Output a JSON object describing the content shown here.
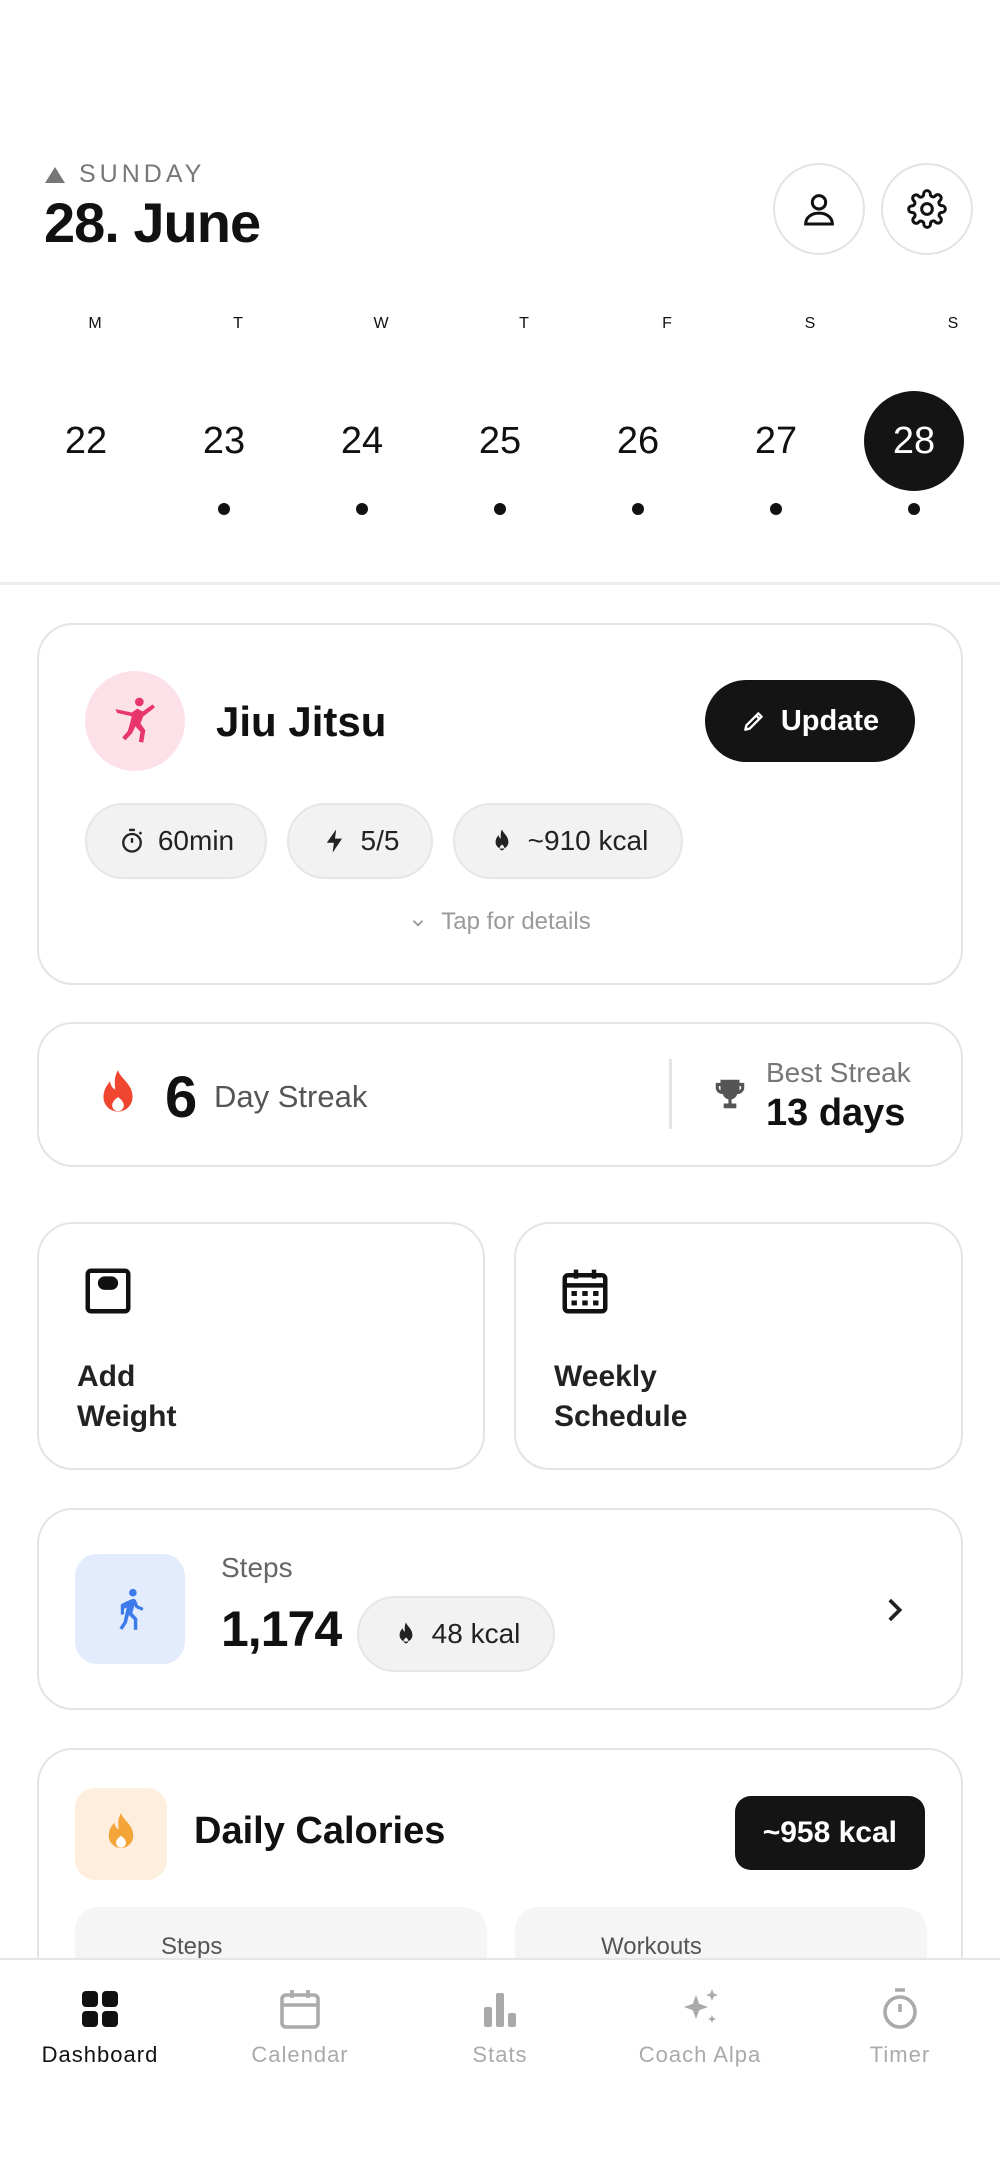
{
  "header": {
    "weekday": "SUNDAY",
    "date": "28. June",
    "week_days": [
      {
        "letter": "M",
        "date": "22",
        "has_dot": false,
        "active": false
      },
      {
        "letter": "T",
        "date": "23",
        "has_dot": true,
        "active": false
      },
      {
        "letter": "W",
        "date": "24",
        "has_dot": true,
        "active": false
      },
      {
        "letter": "T",
        "date": "25",
        "has_dot": true,
        "active": false
      },
      {
        "letter": "F",
        "date": "26",
        "has_dot": true,
        "active": false
      },
      {
        "letter": "S",
        "date": "27",
        "has_dot": true,
        "active": false
      },
      {
        "letter": "S",
        "date": "28",
        "has_dot": true,
        "active": true
      }
    ]
  },
  "activity": {
    "name": "Jiu Jitsu",
    "update_label": "Update",
    "duration": "60min",
    "intensity": "5/5",
    "calories": "~910 kcal",
    "details_hint": "Tap for details"
  },
  "streak": {
    "count": "6",
    "label": "Day Streak",
    "best_label": "Best Streak",
    "best_value": "13 days"
  },
  "tiles": {
    "weight_line1": "Add",
    "weight_line2": "Weight",
    "schedule_line1": "Weekly",
    "schedule_line2": "Schedule"
  },
  "steps": {
    "label": "Steps",
    "value": "1,174",
    "calories": "48 kcal"
  },
  "daily_calories": {
    "title": "Daily Calories",
    "total": "~958 kcal",
    "sub_steps": "Steps",
    "sub_workouts": "Workouts"
  },
  "nav": {
    "items": [
      {
        "label": "Dashboard",
        "icon": "dashboard-icon",
        "active": true
      },
      {
        "label": "Calendar",
        "icon": "calendar-icon",
        "active": false
      },
      {
        "label": "Stats",
        "icon": "stats-icon",
        "active": false
      },
      {
        "label": "Coach Alpa",
        "icon": "sparkle-icon",
        "active": false
      },
      {
        "label": "Timer",
        "icon": "timer-icon",
        "active": false
      }
    ]
  },
  "colors": {
    "accent_dark": "#141414",
    "activity_pink": "#e8356b",
    "flame_red": "#f0452f",
    "flame_orange": "#f3a53a",
    "steps_blue": "#3d7bea"
  }
}
